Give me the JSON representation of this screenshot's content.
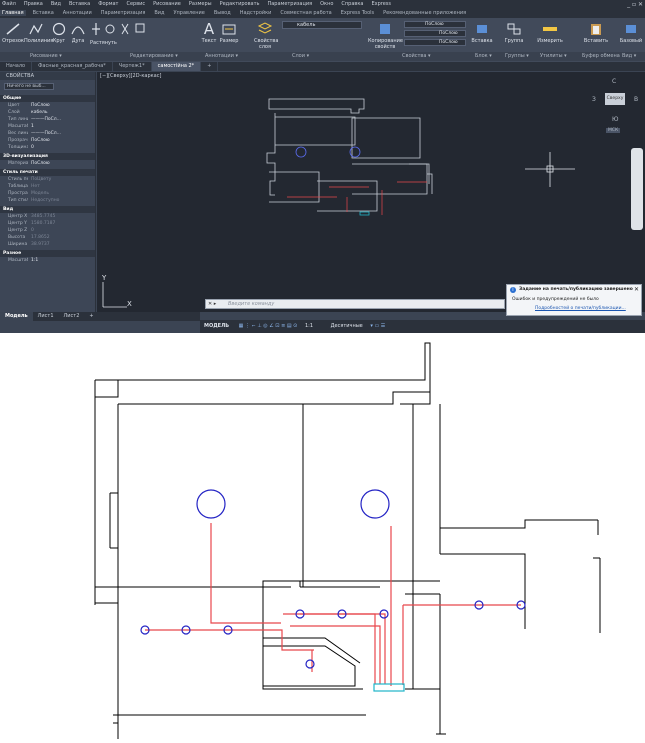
{
  "menu": [
    "Файл",
    "Правка",
    "Вид",
    "Вставка",
    "Формат",
    "Сервис",
    "Рисование",
    "Размеры",
    "Редактировать",
    "Параметризация",
    "Окно",
    "Справка",
    "Express"
  ],
  "ribbon_tabs": {
    "items": [
      "Главная",
      "Вставка",
      "Аннотации",
      "Параметризация",
      "Вид",
      "Управление",
      "Вывод",
      "Надстройки",
      "Совместная работа",
      "Express Tools",
      "Рекомендованные приложения"
    ],
    "active_index": 0
  },
  "ribbon_tools": {
    "line": "Отрезок",
    "polyline": "Полилиния",
    "circle": "Круг",
    "arc": "Дуга",
    "stretch": "Растянуть",
    "text": "Текст",
    "dimension": "Размер",
    "layer_props": "Свойства слоя",
    "layer_name": "кабель",
    "copy_props": "Копирование свойств",
    "bylayer1": "ПоСлою",
    "bylayer2": "ПоСлою",
    "bylayer3": "ПоСлою",
    "insert": "Вставка",
    "group": "Группа",
    "measure": "Измерить",
    "paste": "Вставить",
    "base": "Базовый"
  },
  "panel_labels": [
    "Рисование ▾",
    "Редактирование ▾",
    "Аннотации ▾",
    "Слои ▾",
    "Свойства ▾",
    "Блок ▾",
    "Группы ▾",
    "Утилиты ▾",
    "Буфер обмена",
    "Вид ▾"
  ],
  "doc_tabs": {
    "items": [
      "Начало",
      "Фасные_красная_рабоча*",
      "Чертеж1*",
      "самостійна 2*",
      "+"
    ],
    "active_index": 3
  },
  "properties": {
    "title": "СВОЙСТВА",
    "selection": "Ничего не выб...",
    "sections": [
      {
        "name": "Общие",
        "rows": [
          [
            "Цвет",
            "ПоСлою"
          ],
          [
            "Слой",
            "кабель"
          ],
          [
            "Тип линий",
            "———ПоСл..."
          ],
          [
            "Масштаб...",
            "1"
          ],
          [
            "Вес линий",
            "———ПоСл..."
          ],
          [
            "Прозрач...",
            "ПоСлою"
          ],
          [
            "Толщина",
            "0"
          ]
        ]
      },
      {
        "name": "3D-визуализация",
        "rows": [
          [
            "Материал",
            "ПоСлою"
          ]
        ]
      },
      {
        "name": "Стиль печати",
        "rows": [
          [
            "Стиль пе...",
            "ПоЦвету"
          ],
          [
            "Таблица...",
            "Нет"
          ],
          [
            "Простран...",
            "Модель"
          ],
          [
            "Тип стиля...",
            "Недоступно"
          ]
        ]
      },
      {
        "name": "Вид",
        "rows": [
          [
            "Центр X",
            "3485.7745"
          ],
          [
            "Центр Y",
            "1580.7187"
          ],
          [
            "Центр Z",
            "0"
          ],
          [
            "Высота",
            "17.8652"
          ],
          [
            "Ширина",
            "38.9737"
          ]
        ]
      },
      {
        "name": "Разное",
        "rows": [
          [
            "Масштаб...",
            "1:1"
          ]
        ]
      }
    ]
  },
  "viewport_label": "[−][Сверху][2D-каркас]",
  "viewcube": {
    "north": "С",
    "south": "Ю",
    "west": "З",
    "east": "В",
    "face": "Сверху",
    "wcs": "МСК"
  },
  "command_line": {
    "placeholder": "Введите команду"
  },
  "notification": {
    "title": "Задание на печать/публикацию завершено",
    "line1": "Ошибок и предупреждений не было",
    "link": "Подробностей о печати/публикации..."
  },
  "layout_tabs": {
    "items": [
      "Модель",
      "Лист1",
      "Лист2",
      "+"
    ],
    "active_index": 0
  },
  "status": {
    "model": "МОДЕЛЬ",
    "zoom": "1:1",
    "units": "Десятичные"
  },
  "colors": {
    "wire": "#e8474c",
    "device": "#2323c4",
    "wall": "#000000",
    "accent_cyan": "#1fb5c9"
  }
}
